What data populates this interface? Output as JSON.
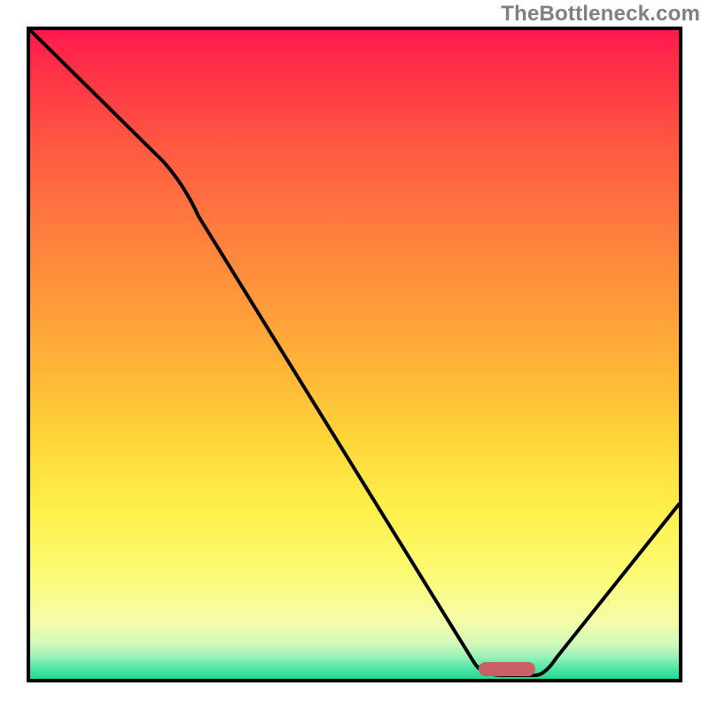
{
  "watermark": {
    "text": "TheBottleneck.com"
  },
  "chart_data": {
    "type": "line",
    "title": "",
    "xlabel": "",
    "ylabel": "",
    "xlim": [
      0,
      100
    ],
    "ylim": [
      0,
      100
    ],
    "series": [
      {
        "name": "bottleneck-curve",
        "x": [
          0,
          18,
          24,
          67,
          73,
          78,
          100
        ],
        "values": [
          100,
          80,
          73,
          2,
          1,
          1,
          27
        ]
      }
    ],
    "marker": {
      "name": "optimal-range-pill",
      "x_range": [
        70,
        78
      ],
      "y": 1,
      "color": "#c86066"
    },
    "background_gradient": {
      "top": "#ff1a4d",
      "mid": "#ffd83a",
      "bottom": "#1fd890"
    }
  }
}
